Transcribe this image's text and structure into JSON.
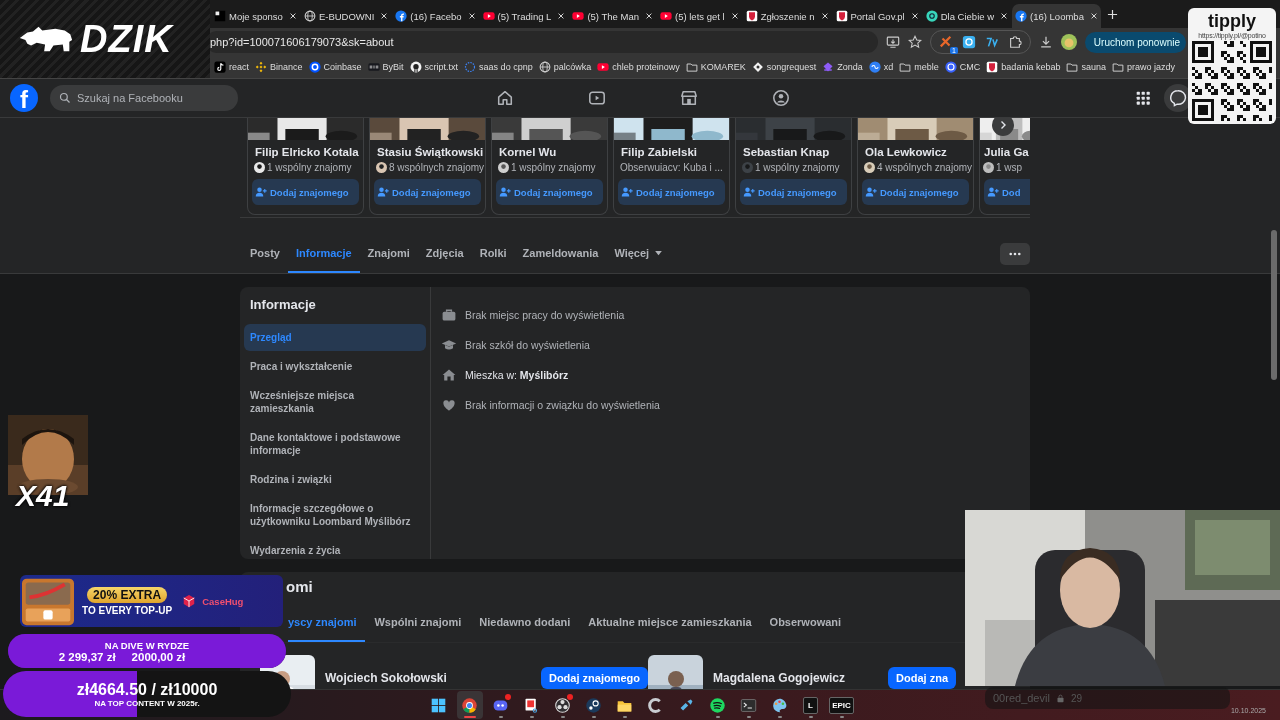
{
  "browser": {
    "tabs": [
      {
        "title": "Moje sponso",
        "kind": "square",
        "selected": false
      },
      {
        "title": "E-BUDOWNI",
        "kind": "globe",
        "selected": false
      },
      {
        "title": "(16) Facebo",
        "kind": "facebook",
        "selected": false
      },
      {
        "title": "(5) Trading L",
        "kind": "youtube",
        "selected": false
      },
      {
        "title": "(5) The Man",
        "kind": "youtube",
        "selected": false
      },
      {
        "title": "(5) lets get l",
        "kind": "youtube",
        "selected": false
      },
      {
        "title": "Zgłoszenie n",
        "kind": "gov",
        "selected": false
      },
      {
        "title": "Portal Gov.pl",
        "kind": "gov",
        "selected": false
      },
      {
        "title": "Dla Ciebie w",
        "kind": "teal",
        "selected": false
      },
      {
        "title": "(16) Loomba",
        "kind": "facebook",
        "selected": true
      }
    ],
    "url": "php?id=100071606179073&sk=about",
    "extension_badge": "1",
    "restart_button": "Uruchom ponownie",
    "bookmarks": [
      {
        "label": "react",
        "kind": "tiktok"
      },
      {
        "label": "Binance",
        "kind": "binance"
      },
      {
        "label": "Coinbase",
        "kind": "coinbase"
      },
      {
        "label": "ByBit",
        "kind": "bybit"
      },
      {
        "label": "script.txt",
        "kind": "github"
      },
      {
        "label": "saas do cpnp",
        "kind": "ring"
      },
      {
        "label": "palcówka",
        "kind": "globe"
      },
      {
        "label": "chleb proteinowy",
        "kind": "youtube"
      },
      {
        "label": "KOMAREK",
        "kind": "folder"
      },
      {
        "label": "songrequest",
        "kind": "diamond"
      },
      {
        "label": "Zonda",
        "kind": "zonda"
      },
      {
        "label": "xd",
        "kind": "link"
      },
      {
        "label": "meble",
        "kind": "folder"
      },
      {
        "label": "CMC",
        "kind": "cmc"
      },
      {
        "label": "badania kebab",
        "kind": "gov"
      },
      {
        "label": "sauna",
        "kind": "folder"
      },
      {
        "label": "prawo jazdy",
        "kind": "folder"
      }
    ]
  },
  "facebook": {
    "logo": "f",
    "search": {
      "placeholder": "Szukaj na Facebooku"
    },
    "nav": [
      {
        "kind": "home"
      },
      {
        "kind": "video"
      },
      {
        "kind": "marketplace"
      },
      {
        "kind": "groups"
      }
    ],
    "suggestions": [
      {
        "name": "Filip Elricko Kotala",
        "kind": "mutual",
        "detail": "1 wspólny znajomy",
        "button": "Dodaj znajomego"
      },
      {
        "name": "Stasiu Świątkowski",
        "kind": "mutual",
        "detail": "8 wspólnych znajomy",
        "button": "Dodaj znajomego"
      },
      {
        "name": "Kornel Wu",
        "kind": "mutual",
        "detail": "1 wspólny znajomy",
        "button": "Dodaj znajomego"
      },
      {
        "name": "Filip Zabielski",
        "kind": "followers",
        "detail": "Obserwuiacv: Kuba i ...",
        "button": "Dodaj znajomego"
      },
      {
        "name": "Sebastian Knap",
        "kind": "mutual",
        "detail": "1 wspólny znajomy",
        "button": "Dodaj znajomego"
      },
      {
        "name": "Ola Lewkowicz",
        "kind": "mutual",
        "detail": "4 wspólnych znajomy",
        "button": "Dodaj znajomego"
      },
      {
        "name": "Julia Ga",
        "kind": "mutual",
        "detail": "1 wsp",
        "button": "Dod"
      }
    ],
    "profile_tabs": [
      {
        "label": "Posty",
        "kind": "tab",
        "selected": false
      },
      {
        "label": "Informacje",
        "kind": "tab",
        "selected": true
      },
      {
        "label": "Znajomi",
        "kind": "tab",
        "selected": false
      },
      {
        "label": "Zdjęcia",
        "kind": "tab",
        "selected": false
      },
      {
        "label": "Rolki",
        "kind": "tab",
        "selected": false
      },
      {
        "label": "Zameldowania",
        "kind": "tab",
        "selected": false
      },
      {
        "label": "Więcej",
        "kind": "menu",
        "selected": false
      }
    ],
    "about": {
      "title": "Informacje",
      "sections": [
        {
          "label": "Przegląd",
          "selected": true
        },
        {
          "label": "Praca i wykształcenie",
          "selected": false
        },
        {
          "label": "Wcześniejsze miejsca zamieszkania",
          "selected": false
        },
        {
          "label": "Dane kontaktowe i podstawowe informacje",
          "selected": false
        },
        {
          "label": "Rodzina i związki",
          "selected": false
        },
        {
          "label": "Informacje szczegółowe o użytkowniku Loombard Myślibórz",
          "selected": false
        },
        {
          "label": "Wydarzenia z życia",
          "selected": false
        }
      ],
      "overview": [
        {
          "kind": "work",
          "text": "Brak miejsc pracy do wyświetlenia"
        },
        {
          "kind": "school",
          "text": "Brak szkół do wyświetlenia"
        },
        {
          "kind": "home",
          "text": "Mieszka w: **Myślibórz**"
        },
        {
          "kind": "heart",
          "text": "Brak informacji o związku do wyświetlenia"
        }
      ]
    },
    "friends": {
      "title": "omi",
      "tabs": [
        {
          "label": "yscy znajomi",
          "selected": true
        },
        {
          "label": "Wspólni znajomi",
          "selected": false
        },
        {
          "label": "Niedawno dodani",
          "selected": false
        },
        {
          "label": "Aktualne miejsce zamieszkania",
          "selected": false
        },
        {
          "label": "Obserwowani",
          "selected": false
        }
      ],
      "list": [
        {
          "name": "Wojciech Sokołowski",
          "button": "Dodaj znajomego"
        },
        {
          "name": "Magdalena Gogojewicz",
          "button": "Dodaj zna"
        }
      ]
    }
  },
  "overlay": {
    "logo": "DZIK",
    "tipply": {
      "brand": "tipply",
      "url": "https://tipply.pl/@potino"
    },
    "emote": {
      "count": "X41"
    },
    "promo": {
      "headline": "20% EXTRA",
      "subline": "TO EVERY TOP-UP",
      "brand": "CaseHug"
    },
    "goals": [
      {
        "kind": "split",
        "title": "NA DIVĘ W RYDZE",
        "raised": "2 299,37 zł",
        "target": "2000,00 zł",
        "level": 1
      },
      {
        "kind": "total",
        "amount": "zł4664.50 / zł10000",
        "title": "NA TOP CONTENT W 2025r.",
        "level": 0.466
      }
    ],
    "chat": {
      "user": "00red_devil",
      "count": "29"
    }
  },
  "taskbar": {
    "apps": [
      {
        "kind": "start",
        "selected": false,
        "running": false,
        "alert": false
      },
      {
        "kind": "chrome",
        "selected": true,
        "running": true,
        "alert": false
      },
      {
        "kind": "discord",
        "selected": false,
        "running": true,
        "alert": true
      },
      {
        "kind": "snip",
        "selected": false,
        "running": true,
        "alert": false
      },
      {
        "kind": "obs",
        "selected": false,
        "running": true,
        "alert": true
      },
      {
        "kind": "steam",
        "selected": false,
        "running": true,
        "alert": false
      },
      {
        "kind": "files",
        "selected": false,
        "running": true,
        "alert": false
      },
      {
        "kind": "cleaner",
        "selected": false,
        "running": false,
        "alert": false
      },
      {
        "kind": "tool",
        "selected": false,
        "running": false,
        "alert": false
      },
      {
        "kind": "spotify",
        "selected": false,
        "running": true,
        "alert": false
      },
      {
        "kind": "terminal",
        "selected": false,
        "running": true,
        "alert": false
      },
      {
        "kind": "paint",
        "selected": false,
        "running": true,
        "alert": false
      },
      {
        "kind": "letter",
        "label": "L",
        "selected": false,
        "running": true,
        "alert": false
      },
      {
        "kind": "letter",
        "label": "EPIC",
        "selected": false,
        "running": true,
        "alert": false
      }
    ],
    "date": "10.10.2025"
  }
}
